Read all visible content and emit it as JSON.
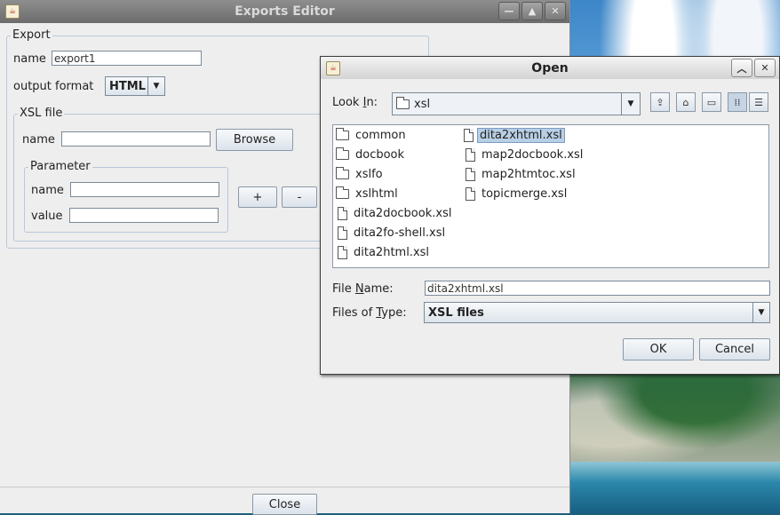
{
  "main": {
    "title": "Exports Editor",
    "export_group": "Export",
    "name_label": "name",
    "name_value": "export1",
    "output_format_label": "output format",
    "output_format_value": "HTML",
    "xsl_group": "XSL file",
    "xsl_name_label": "name",
    "xsl_name_value": "",
    "browse": "Browse",
    "param_group": "Parameter",
    "param_name_label": "name",
    "param_value_label": "value",
    "add": "+",
    "remove": "-",
    "close": "Close"
  },
  "dialog": {
    "title": "Open",
    "look_in_label_pre": "Look ",
    "look_in_label_u": "I",
    "look_in_label_post": "n:",
    "look_in_value": "xsl",
    "files": [
      {
        "name": "common",
        "type": "folder"
      },
      {
        "name": "docbook",
        "type": "folder"
      },
      {
        "name": "xslfo",
        "type": "folder"
      },
      {
        "name": "xslhtml",
        "type": "folder"
      },
      {
        "name": "dita2docbook.xsl",
        "type": "file"
      },
      {
        "name": "dita2fo-shell.xsl",
        "type": "file"
      },
      {
        "name": "dita2html.xsl",
        "type": "file"
      },
      {
        "name": "dita2xhtml.xsl",
        "type": "file",
        "selected": true
      },
      {
        "name": "map2docbook.xsl",
        "type": "file"
      },
      {
        "name": "map2htmtoc.xsl",
        "type": "file"
      },
      {
        "name": "topicmerge.xsl",
        "type": "file"
      }
    ],
    "file_name_label_pre": "File ",
    "file_name_label_u": "N",
    "file_name_label_post": "ame:",
    "file_name_value": "dita2xhtml.xsl",
    "file_type_label_pre": "Files of ",
    "file_type_label_u": "T",
    "file_type_label_post": "ype:",
    "file_type_value": "XSL files",
    "ok": "OK",
    "cancel": "Cancel"
  }
}
